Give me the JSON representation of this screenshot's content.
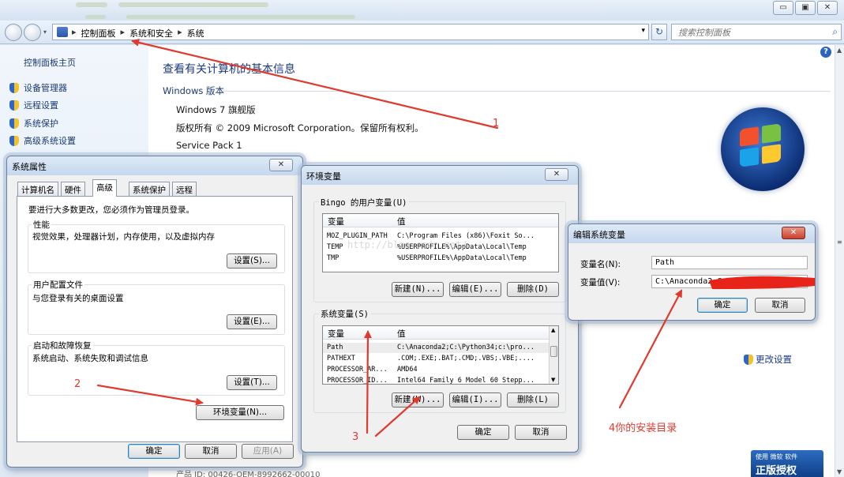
{
  "window": {
    "controls": [
      "▭",
      "▣",
      "✕"
    ]
  },
  "addressbar": {
    "crumbs": [
      "控制面板",
      "系统和安全",
      "系统"
    ],
    "search_placeholder": "搜索控制面板"
  },
  "sidebar": {
    "home": "控制面板主页",
    "links": [
      "设备管理器",
      "远程设置",
      "系统保护",
      "高级系统设置"
    ]
  },
  "main": {
    "title": "查看有关计算机的基本信息",
    "section": "Windows 版本",
    "edition": "Windows 7 旗舰版",
    "copyright": "版权所有 © 2009 Microsoft Corporation。保留所有权利。",
    "service_pack": "Service Pack 1",
    "change_settings": "更改设置",
    "product_id": "产品 ID: 00426-OEM-8992662-00010",
    "genuine_line1": "使用 微软 软件",
    "genuine_line2": "正版授权"
  },
  "sysprops": {
    "title": "系统属性",
    "close": "✕",
    "tabs": [
      "计算机名",
      "硬件",
      "高级",
      "系统保护",
      "远程"
    ],
    "admin_note": "要进行大多数更改，您必须作为管理员登录。",
    "perf_label": "性能",
    "perf_desc": "视觉效果，处理器计划，内存使用，以及虚拟内存",
    "perf_btn": "设置(S)...",
    "profile_label": "用户配置文件",
    "profile_desc": "与您登录有关的桌面设置",
    "profile_btn": "设置(E)...",
    "startup_label": "启动和故障恢复",
    "startup_desc": "系统启动、系统失败和调试信息",
    "startup_btn": "设置(T)...",
    "env_btn": "环境变量(N)...",
    "ok": "确定",
    "cancel": "取消",
    "apply": "应用(A)"
  },
  "envvars": {
    "title": "环境变量",
    "close": "✕",
    "user_group": "Bingo 的用户变量(U)",
    "col_var": "变量",
    "col_val": "值",
    "user_rows": [
      {
        "var": "MOZ_PLUGIN_PATH",
        "val": "C:\\Program Files (x86)\\Foxit So..."
      },
      {
        "var": "TEMP",
        "val": "%USERPROFILE%\\AppData\\Local\\Temp"
      },
      {
        "var": "TMP",
        "val": "%USERPROFILE%\\AppData\\Local\\Temp"
      }
    ],
    "new_user": "新建(N)...",
    "edit_user": "编辑(E)...",
    "delete_user": "删除(D)",
    "sys_group": "系统变量(S)",
    "sys_rows": [
      {
        "var": "Path",
        "val": "C:\\Anaconda2;C:\\Python34;c:\\pro..."
      },
      {
        "var": "PATHEXT",
        "val": ".COM;.EXE;.BAT;.CMD;.VBS;.VBE;...."
      },
      {
        "var": "PROCESSOR_AR...",
        "val": "AMD64"
      },
      {
        "var": "PROCESSOR_ID...",
        "val": "Intel64 Family 6 Model 60 Stepp..."
      }
    ],
    "new_sys": "新建(W)...",
    "edit_sys": "编辑(I)...",
    "delete_sys": "删除(L)",
    "ok": "确定",
    "cancel": "取消",
    "watermark": "http://blog.csdn.net/"
  },
  "editvar": {
    "title": "编辑系统变量",
    "close": "✕",
    "name_label": "变量名(N):",
    "name_value": "Path",
    "value_label": "变量值(V):",
    "value_value": "C:\\Anaconda2;C",
    "ok": "确定",
    "cancel": "取消"
  },
  "annotations": {
    "a1": "1",
    "a2": "2",
    "a3": "3",
    "a4": "4你的安装目录"
  }
}
